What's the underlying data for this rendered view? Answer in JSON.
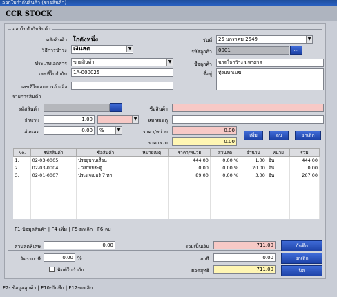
{
  "window_title": "ออกใบกำกับสินค้า (ขายสินค้า)",
  "header_title": "CCR STOCK",
  "doc_group": {
    "legend": "ออกใบกำกับสินค้า",
    "warehouse_label": "คลังสินค้า",
    "warehouse_value": "โกดังหนึ่ง",
    "payment_label": "วิธีการชำระ",
    "payment_value": "เงินสด",
    "doc_type_label": "ประเภทเอกสาร",
    "doc_type_value": "ขายสินค้า",
    "invoice_no_label": "เลขที่ใบกำกับ",
    "invoice_no_value": "1A-000025",
    "ref_doc_label": "เลขที่ใบเอกสารอ้างอิง",
    "ref_doc_value": "",
    "date_label": "วันที่",
    "date_value": "25  มกราคม    2549",
    "cust_code_label": "รหัสลูกค้า",
    "cust_code_value": "0001",
    "cust_name_label": "ชื่อลูกค้า",
    "cust_name_value": "นายใจกว้าง  มหาศาล",
    "address_label": "ที่อยู่",
    "address_value": "ทุ่งมหาเมฆ",
    "browse_label": "..."
  },
  "items_group": {
    "legend": "รายการสินค้า",
    "code_label": "รหัสสินค้า",
    "code_value": "",
    "qty_label": "จำนวน",
    "qty_value": "1.00",
    "discount_label": "ส่วนลด",
    "discount_value": "0.00",
    "discount_unit": "%",
    "name_label": "ชื่อสินค้า",
    "name_value": "",
    "note_label": "หมายเหตุ",
    "note_value": "",
    "unit_price_label": "ราคา/หน่วย",
    "unit_price_value": "0.00",
    "total_label": "ราคารวม",
    "total_value": "0.00",
    "add_button": "เพิ่ม",
    "delete_button": "ลบ",
    "cancel_button": "ยกเลิก",
    "columns": [
      "No.",
      "รหัสสินค้า",
      "ชื่อสินค้า",
      "หมายเหตุ",
      "ราคา/หน่วย",
      "ส่วนลด",
      "จำนวน",
      "หน่วย",
      "รวม"
    ],
    "rows": [
      [
        "1.",
        "02-03-0005",
        "ปรอยูบานเรือน",
        "",
        "444.00",
        "0.00 %",
        "1.00",
        "อัน",
        "444.00"
      ],
      [
        "2.",
        "02-03-0004",
        " - วงกบประตู",
        "",
        "0.00",
        "0.00 %",
        "20.00",
        "อัน",
        "0.00"
      ],
      [
        "3.",
        "02-01-0007",
        "ประแจเบอร์ 7 ทก",
        "",
        "89.00",
        "0.00 %",
        "3.00",
        "อัน",
        "267.00"
      ]
    ],
    "hint": "F1-ข้อมูลสินค้า  |  F4-เพิ่ม  |  F5-ยกเลิก  |  F6-ลบ"
  },
  "summary": {
    "special_discount_label": "ส่วนลดพิเศษ",
    "special_discount_value": "0.00",
    "tax_rate_label": "อัตราภาษี",
    "tax_rate_value": "0.00",
    "tax_rate_unit": "%",
    "print_invoice_label": "พิมพ์ใบกำกับ",
    "subtotal_label": "รวมเป็นเงิน",
    "subtotal_value": "711.00",
    "tax_label": "ภาษี",
    "tax_value": "0.00",
    "net_label": "ยอดสุทธิ",
    "net_value": "711.00",
    "save_button": "บันทึก",
    "cancel_button": "ยกเลิก",
    "close_button": "ปิด"
  },
  "status_hint": "F2- ข้อมูลลูกค้า   |  F10-บันทึก   |  F12-ยกเลิก"
}
